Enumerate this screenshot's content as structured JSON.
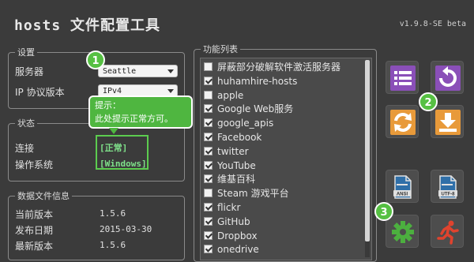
{
  "app": {
    "title_latin": "hosts",
    "title_cn": "文件配置工具",
    "version": "v1.9.8-SE beta"
  },
  "settings": {
    "title": "设置",
    "server_label": "服务器",
    "server_value": "Seattle",
    "ip_label": "IP 协议版本",
    "ip_value": "IPv4"
  },
  "status": {
    "title": "状态",
    "connection_label": "连接",
    "connection_value": "[正常]",
    "os_label": "操作系统",
    "os_value": "[Windows]"
  },
  "info": {
    "title": "数据文件信息",
    "current_label": "当前版本",
    "current_value": "1.5.6",
    "date_label": "发布日期",
    "date_value": "2015-03-30",
    "latest_label": "最新版本",
    "latest_value": "1.5.6"
  },
  "functions": {
    "title": "功能列表",
    "items": [
      {
        "label": "屏蔽部分破解软件激活服务器",
        "checked": false
      },
      {
        "label": "huhamhire-hosts",
        "checked": true
      },
      {
        "label": "apple",
        "checked": false
      },
      {
        "label": "Google Web服务",
        "checked": true
      },
      {
        "label": "google_apis",
        "checked": true
      },
      {
        "label": "Facebook",
        "checked": true
      },
      {
        "label": "twitter",
        "checked": true
      },
      {
        "label": "YouTube",
        "checked": true
      },
      {
        "label": "维基百科",
        "checked": true
      },
      {
        "label": "Steam 游戏平台",
        "checked": false
      },
      {
        "label": "flickr",
        "checked": true
      },
      {
        "label": "GitHub",
        "checked": true
      },
      {
        "label": "Dropbox",
        "checked": true
      },
      {
        "label": "onedrive",
        "checked": true
      }
    ]
  },
  "tooltip": {
    "line1": "提示：",
    "line2": "此处提示正常方可。"
  },
  "badges": {
    "one": "1",
    "two": "2",
    "three": "3"
  },
  "buttons": {
    "ansi_label": "ANSI",
    "utf8_label": "UTF-8"
  },
  "colors": {
    "background": "#3b3b3b",
    "accent_green": "#56c043",
    "purple": "#8a4fb8",
    "orange": "#e89a3a",
    "red": "#e0432e"
  }
}
